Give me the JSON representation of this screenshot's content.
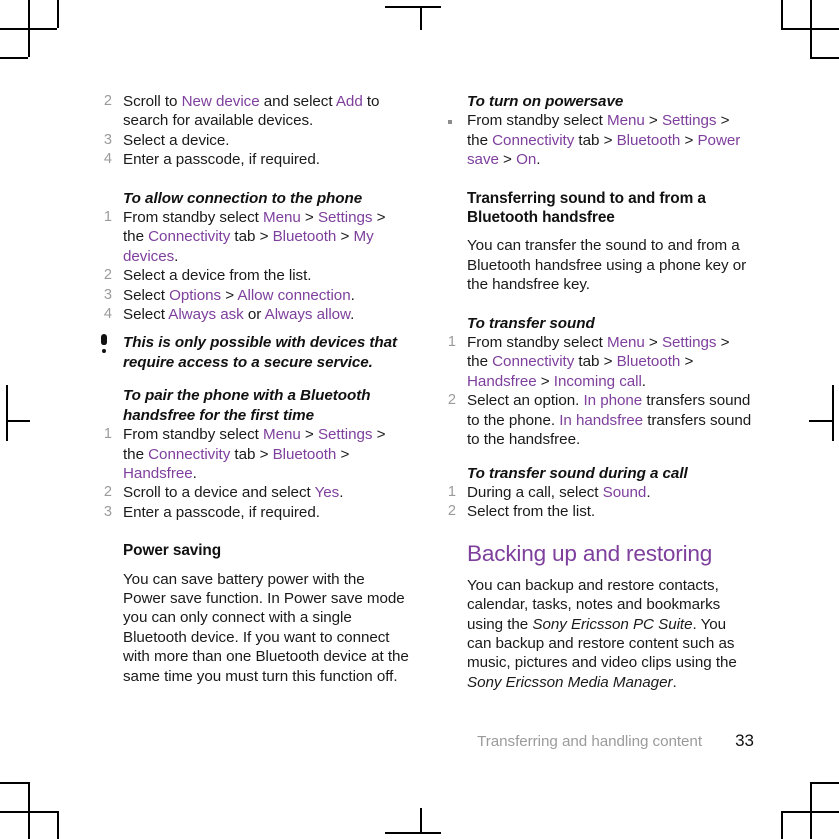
{
  "document": {
    "page_number": "33",
    "footer_chapter": "Transferring and handling content"
  },
  "left_column": {
    "list_pair_top": [
      {
        "num": "2",
        "text_html": "Scroll to <span class=\"kw\">New device</span> and select <span class=\"kw\">Add</span> to search for available devices."
      },
      {
        "num": "3",
        "text_html": "Select a device."
      },
      {
        "num": "4",
        "text_html": "Enter a passcode, if required."
      }
    ],
    "proc_allow_connection": {
      "title": "To allow connection to the phone",
      "steps": [
        {
          "num": "1",
          "text_html": "From standby select <span class=\"kw\">Menu</span> &gt; <span class=\"kw\">Settings</span> &gt; the <span class=\"kw\">Connectivity</span> tab &gt; <span class=\"kw\">Bluetooth</span> &gt; <span class=\"kw\">My devices</span>."
        },
        {
          "num": "2",
          "text_html": "Select a device from the list."
        },
        {
          "num": "3",
          "text_html": "Select <span class=\"kw\">Options</span> &gt; <span class=\"kw\">Allow connection</span>."
        },
        {
          "num": "4",
          "text_html": "Select <span class=\"kw\">Always ask</span> or <span class=\"kw\">Always allow</span>."
        }
      ]
    },
    "note": "This is only possible with devices that require access to a secure service.",
    "proc_pair_handsfree": {
      "title": "To pair the phone with a Bluetooth handsfree for the first time",
      "steps": [
        {
          "num": "1",
          "text_html": "From standby select <span class=\"kw\">Menu</span> &gt; <span class=\"kw\">Settings</span> &gt; the <span class=\"kw\">Connectivity</span> tab &gt; <span class=\"kw\">Bluetooth</span> &gt; <span class=\"kw\">Handsfree</span>."
        },
        {
          "num": "2",
          "text_html": "Scroll to a device and select <span class=\"kw\">Yes</span>."
        },
        {
          "num": "3",
          "text_html": "Enter a passcode, if required."
        }
      ]
    },
    "power_saving": {
      "heading": "Power saving",
      "body": "You can save battery power with the Power save function. In Power save mode you can only connect with a single Bluetooth device. If you want to connect with more than one Bluetooth device at the same time you must turn this function off."
    }
  },
  "right_column": {
    "proc_powersave": {
      "title": "To turn on powersave",
      "steps": [
        {
          "bullet": "▪",
          "text_html": "From standby select <span class=\"kw\">Menu</span> &gt; <span class=\"kw\">Settings</span> &gt; the <span class=\"kw\">Connectivity</span> tab &gt; <span class=\"kw\">Bluetooth</span> &gt; <span class=\"kw\">Power save</span> &gt; <span class=\"kw\">On</span>."
        }
      ]
    },
    "transferring_sound": {
      "heading": "Transferring sound to and from a Bluetooth handsfree",
      "body": "You can transfer the sound to and from a Bluetooth handsfree using a phone key or the handsfree key."
    },
    "proc_transfer_sound": {
      "title": "To transfer sound",
      "steps": [
        {
          "num": "1",
          "text_html": "From standby select <span class=\"kw\">Menu</span> &gt; <span class=\"kw\">Settings</span> &gt; the <span class=\"kw\">Connectivity</span> tab &gt; <span class=\"kw\">Bluetooth</span> &gt; <span class=\"kw\">Handsfree</span> &gt; <span class=\"kw\">Incoming call</span>."
        },
        {
          "num": "2",
          "text_html": "Select an option. <span class=\"kw\">In phone</span> transfers sound to the phone. <span class=\"kw\">In handsfree</span> transfers sound to the handsfree."
        }
      ]
    },
    "proc_transfer_during_call": {
      "title": "To transfer sound during a call",
      "steps": [
        {
          "num": "1",
          "text_html": "During a call, select <span class=\"kw\">Sound</span>."
        },
        {
          "num": "2",
          "text_html": "Select from the list."
        }
      ]
    },
    "backing_up": {
      "heading": "Backing up and restoring",
      "body_html": "You can backup and restore contacts, calendar, tasks, notes and bookmarks using the <span class=\"it\">Sony Ericsson PC Suite</span>. You can backup and restore content such as music, pictures and video clips using the <span class=\"it\">Sony Ericsson Media Manager</span>."
    }
  },
  "colors": {
    "accent_purple": "#7e3f9d",
    "body_text": "#1a1a1a",
    "muted_gray": "#9b9b9b",
    "crop_mark": "#000000"
  }
}
